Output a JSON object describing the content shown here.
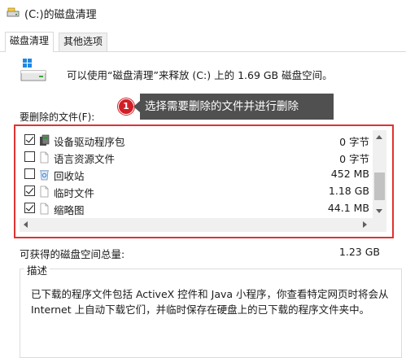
{
  "window": {
    "title": "(C:)的磁盘清理"
  },
  "tabs": [
    {
      "label": "磁盘清理",
      "active": true
    },
    {
      "label": "其他选项",
      "active": false
    }
  ],
  "intro": "可以使用“磁盘清理”来释放  (C:) 上的 1.69 GB 磁盘空间。",
  "files_label": "要删除的文件(F):",
  "callout": {
    "number": "1",
    "text": "选择需要删除的文件并进行删除"
  },
  "files": [
    {
      "name": "设备驱动程序包",
      "size": "0 字节",
      "checked": true,
      "icon": "driver-package-icon"
    },
    {
      "name": "语言资源文件",
      "size": "0 字节",
      "checked": false,
      "icon": "document-icon"
    },
    {
      "name": "回收站",
      "size": "452 MB",
      "checked": false,
      "icon": "recycle-bin-icon"
    },
    {
      "name": "临时文件",
      "size": "1.18 GB",
      "checked": true,
      "icon": "document-icon"
    },
    {
      "name": "缩略图",
      "size": "44.1 MB",
      "checked": true,
      "icon": "document-icon"
    }
  ],
  "total": {
    "label": "可获得的磁盘空间总量:",
    "value": "1.23 GB"
  },
  "description": {
    "title": "描述",
    "text": "已下载的程序文件包括 ActiveX 控件和 Java 小程序，你查看特定网页时将会从 Internet 上自动下载它们，并临时保存在硬盘上的已下载的程序文件夹中。"
  },
  "colors": {
    "highlight": "#e03232",
    "badge": "#d21f27",
    "callout_bg": "#505050"
  }
}
